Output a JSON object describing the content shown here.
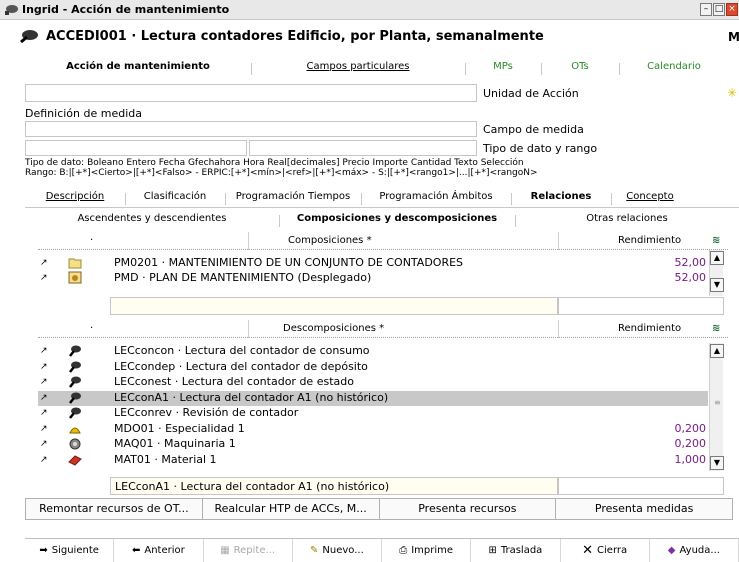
{
  "window": {
    "title": "Ingrid - Acción de mantenimiento"
  },
  "header": {
    "title": "ACCEDI001 · Lectura contadores Edificio, por Planta, semanalmente"
  },
  "top_tabs": [
    {
      "label": "Acción de mantenimiento",
      "active": true
    },
    {
      "label": "Campos particulares"
    },
    {
      "label": "MPs"
    },
    {
      "label": "OTs"
    },
    {
      "label": "Calendario"
    }
  ],
  "form": {
    "unidad_label": "Unidad de Acción",
    "definicion_label": "Definición de medida",
    "campo_label": "Campo de medida",
    "tipo_label": "Tipo de dato y rango",
    "tipo_dato_text": "Tipo de dato: Boleano Entero Fecha Gfechahora Hora Real[decimales] Precio Importe Cantidad Texto Selección",
    "rango_text": "Rango: B:|[+*]<Cierto>|[+*]<Falso> - ERPIC:[+*]<mín>|<ref>|[+*]<máx> - S:|[+*]<rango1>|...|[+*]<rangoN>"
  },
  "section_tabs": [
    {
      "label": "Descripción"
    },
    {
      "label": "Clasificación"
    },
    {
      "label": "Programación Tiempos"
    },
    {
      "label": "Programación Ámbitos"
    },
    {
      "label": "Relaciones",
      "active": true
    },
    {
      "label": "Concepto"
    }
  ],
  "sub_tabs": [
    {
      "label": "Ascendentes y descendientes"
    },
    {
      "label": "Composiciones y descomposiciones",
      "active": true
    },
    {
      "label": "Otras relaciones"
    }
  ],
  "composiciones": {
    "dot": "·",
    "header": "Composiciones *",
    "rend_header": "Rendimiento",
    "rows": [
      {
        "icon": "folder-icon",
        "text": "PM0201 · MANTENIMIENTO DE UN CONJUNTO DE CONTADORES",
        "value": "52,00"
      },
      {
        "icon": "plan-icon",
        "text": "PMD · PLAN DE MANTENIMIENTO (Desplegado)",
        "value": "52,00"
      }
    ]
  },
  "descomposiciones": {
    "dot": "·",
    "header": "Descomposiciones *",
    "rend_header": "Rendimiento",
    "rows": [
      {
        "icon": "action-icon",
        "text": "LECconcon · Lectura del contador de consumo",
        "value": ""
      },
      {
        "icon": "action-icon",
        "text": "LECcondep · Lectura del contador de depósito",
        "value": ""
      },
      {
        "icon": "action-icon",
        "text": "LECconest · Lectura del contador de estado",
        "value": ""
      },
      {
        "icon": "action-icon",
        "text": "LECconA1 · Lectura del contador A1 (no histórico)",
        "value": "",
        "selected": true
      },
      {
        "icon": "action-icon",
        "text": "LECconrev · Revisión de contador",
        "value": ""
      },
      {
        "icon": "worker-icon",
        "text": "MDO01 · Especialidad 1",
        "value": "0,200"
      },
      {
        "icon": "machine-icon",
        "text": "MAQ01 · Maquinaria 1",
        "value": "0,200"
      },
      {
        "icon": "brick-icon",
        "text": "MAT01 · Material 1",
        "value": "1,000"
      }
    ],
    "footer_text": "LECconA1 · Lectura del contador A1 (no histórico)"
  },
  "action_buttons": [
    "Remontar recursos de OT...",
    "Realcular HTP de ACCs, M...",
    "Presenta recursos",
    "Presenta medidas"
  ],
  "footer": [
    {
      "label": "Siguiente",
      "icon": "right-arrow-icon"
    },
    {
      "label": "Anterior",
      "icon": "left-arrow-icon"
    },
    {
      "label": "Repite...",
      "icon": "repeat-icon",
      "disabled": true
    },
    {
      "label": "Nuevo...",
      "icon": "new-icon"
    },
    {
      "label": "Imprime",
      "icon": "printer-icon"
    },
    {
      "label": "Traslada",
      "icon": "move-icon"
    },
    {
      "label": "Cierra",
      "icon": "close-x-icon"
    },
    {
      "label": "Ayuda...",
      "icon": "help-icon"
    }
  ],
  "colors": {
    "value_purple": "#7a1a8a",
    "tab_green": "#2a8a2a",
    "selected_row": "#c8c8c8"
  }
}
